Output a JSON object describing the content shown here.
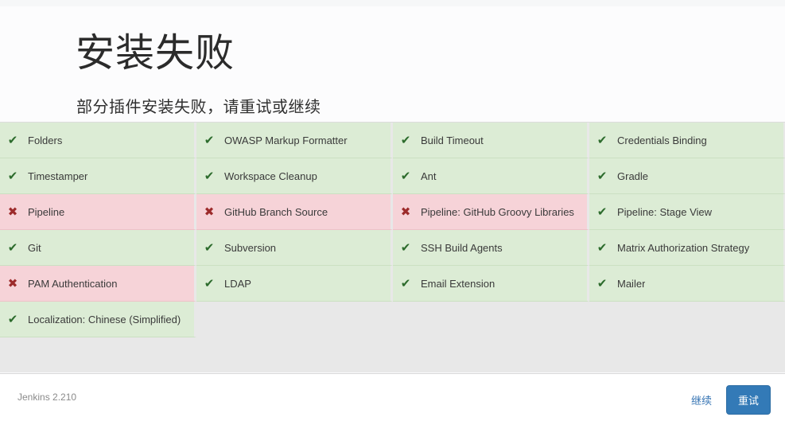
{
  "header": {
    "title": "安装失败",
    "subtitle": "部分插件安装失败，请重试或继续"
  },
  "icons": {
    "success": "✔",
    "failure": "✖",
    "success_name": "check-icon",
    "failure_name": "cross-icon"
  },
  "colors": {
    "success_bg": "#dcecd5",
    "success_icon": "#2c6b2c",
    "failure_bg": "#f6d3d8",
    "failure_icon": "#9c2b2b",
    "accent": "#337ab7",
    "link": "#3a77b5",
    "page_bg": "#e8e8e8"
  },
  "plugins": [
    {
      "name": "Folders",
      "status": "success"
    },
    {
      "name": "OWASP Markup Formatter",
      "status": "success"
    },
    {
      "name": "Build Timeout",
      "status": "success"
    },
    {
      "name": "Credentials Binding",
      "status": "success"
    },
    {
      "name": "Timestamper",
      "status": "success"
    },
    {
      "name": "Workspace Cleanup",
      "status": "success"
    },
    {
      "name": "Ant",
      "status": "success"
    },
    {
      "name": "Gradle",
      "status": "success"
    },
    {
      "name": "Pipeline",
      "status": "failure"
    },
    {
      "name": "GitHub Branch Source",
      "status": "failure"
    },
    {
      "name": "Pipeline: GitHub Groovy Libraries",
      "status": "failure"
    },
    {
      "name": "Pipeline: Stage View",
      "status": "success"
    },
    {
      "name": "Git",
      "status": "success"
    },
    {
      "name": "Subversion",
      "status": "success"
    },
    {
      "name": "SSH Build Agents",
      "status": "success"
    },
    {
      "name": "Matrix Authorization Strategy",
      "status": "success"
    },
    {
      "name": "PAM Authentication",
      "status": "failure"
    },
    {
      "name": "LDAP",
      "status": "success"
    },
    {
      "name": "Email Extension",
      "status": "success"
    },
    {
      "name": "Mailer",
      "status": "success"
    },
    {
      "name": "Localization: Chinese (Simplified)",
      "status": "success"
    }
  ],
  "footer": {
    "version": "Jenkins 2.210",
    "continue_label": "继续",
    "retry_label": "重试"
  }
}
